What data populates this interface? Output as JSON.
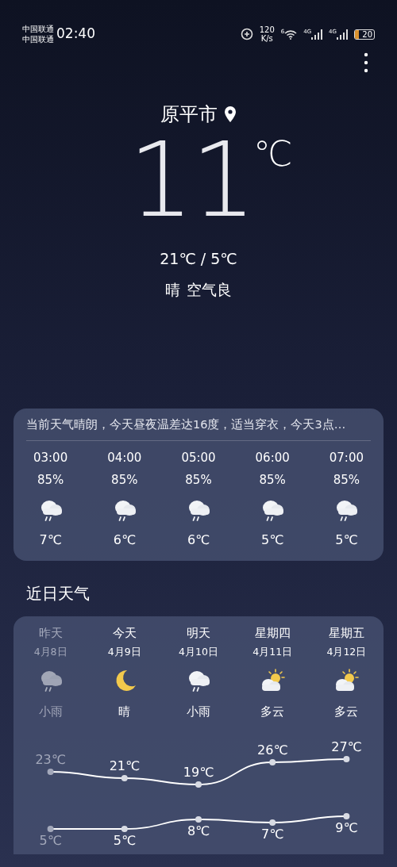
{
  "status_bar": {
    "carriers": [
      "中国联通",
      "中国联通"
    ],
    "time": "02:40",
    "net_speed": [
      "120",
      "K/s"
    ],
    "wifi_label": "6",
    "signal_labels": [
      "4G",
      "4G"
    ],
    "battery": "20"
  },
  "location": {
    "city": "原平市"
  },
  "current": {
    "temperature": "11",
    "unit": "℃",
    "range": "21℃ / 5℃",
    "condition": "晴",
    "air": "空气良"
  },
  "hourly": {
    "summary": "当前天气晴朗，今天昼夜温差达16度，适当穿衣，今天3点…",
    "hours": [
      {
        "time": "03:00",
        "humidity": "85%",
        "kind": "rain",
        "temp": "7℃"
      },
      {
        "time": "04:00",
        "humidity": "85%",
        "kind": "rain",
        "temp": "6℃"
      },
      {
        "time": "05:00",
        "humidity": "85%",
        "kind": "rain",
        "temp": "6℃"
      },
      {
        "time": "06:00",
        "humidity": "85%",
        "kind": "rain",
        "temp": "5℃"
      },
      {
        "time": "07:00",
        "humidity": "85%",
        "kind": "rain",
        "temp": "5℃"
      }
    ]
  },
  "daily": {
    "title": "近日天气",
    "days": [
      {
        "date": "4月8日",
        "kind": "rain",
        "condition": "小雨",
        "past": true
      },
      {
        "date": "4月9日",
        "kind": "moon",
        "condition": "晴",
        "past": false
      },
      {
        "date": "4月10日",
        "kind": "rain",
        "condition": "小雨",
        "past": false
      },
      {
        "date": "4月11日",
        "kind": "partly",
        "condition": "多云",
        "past": false
      },
      {
        "date": "4月12日",
        "kind": "partly",
        "condition": "多云",
        "past": false
      }
    ],
    "chart_data": {
      "type": "line",
      "categories": [
        "昨天",
        "今天",
        "明天",
        "星期四",
        "星期五"
      ],
      "data_labels": true,
      "series": [
        {
          "color": "#ffffff",
          "marker": "circle",
          "values": [
            23,
            21,
            19,
            26,
            27
          ],
          "value_labels": [
            "23℃",
            "21℃",
            "19℃",
            "26℃",
            "27℃"
          ]
        },
        {
          "color": "#ffffff",
          "marker": "circle",
          "values": [
            5,
            5,
            8,
            7,
            9
          ],
          "value_labels": [
            "5℃",
            "5℃",
            "8℃",
            "7℃",
            "9℃"
          ]
        }
      ]
    }
  }
}
